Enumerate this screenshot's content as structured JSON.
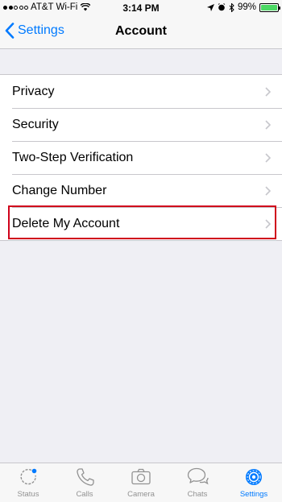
{
  "status_bar": {
    "carrier": "AT&T Wi-Fi",
    "time": "3:14 PM",
    "battery": "99%",
    "battery_level": 0.99
  },
  "nav": {
    "back_label": "Settings",
    "title": "Account"
  },
  "account_options": [
    {
      "label": "Privacy"
    },
    {
      "label": "Security"
    },
    {
      "label": "Two-Step Verification"
    },
    {
      "label": "Change Number"
    },
    {
      "label": "Delete My Account"
    }
  ],
  "tabs": [
    {
      "label": "Status",
      "icon": "status-icon"
    },
    {
      "label": "Calls",
      "icon": "phone-icon"
    },
    {
      "label": "Camera",
      "icon": "camera-icon"
    },
    {
      "label": "Chats",
      "icon": "chats-icon"
    },
    {
      "label": "Settings",
      "icon": "gear-icon",
      "active": true
    }
  ],
  "colors": {
    "accent": "#007aff",
    "highlight": "#d0021b",
    "background": "#efeff4"
  }
}
